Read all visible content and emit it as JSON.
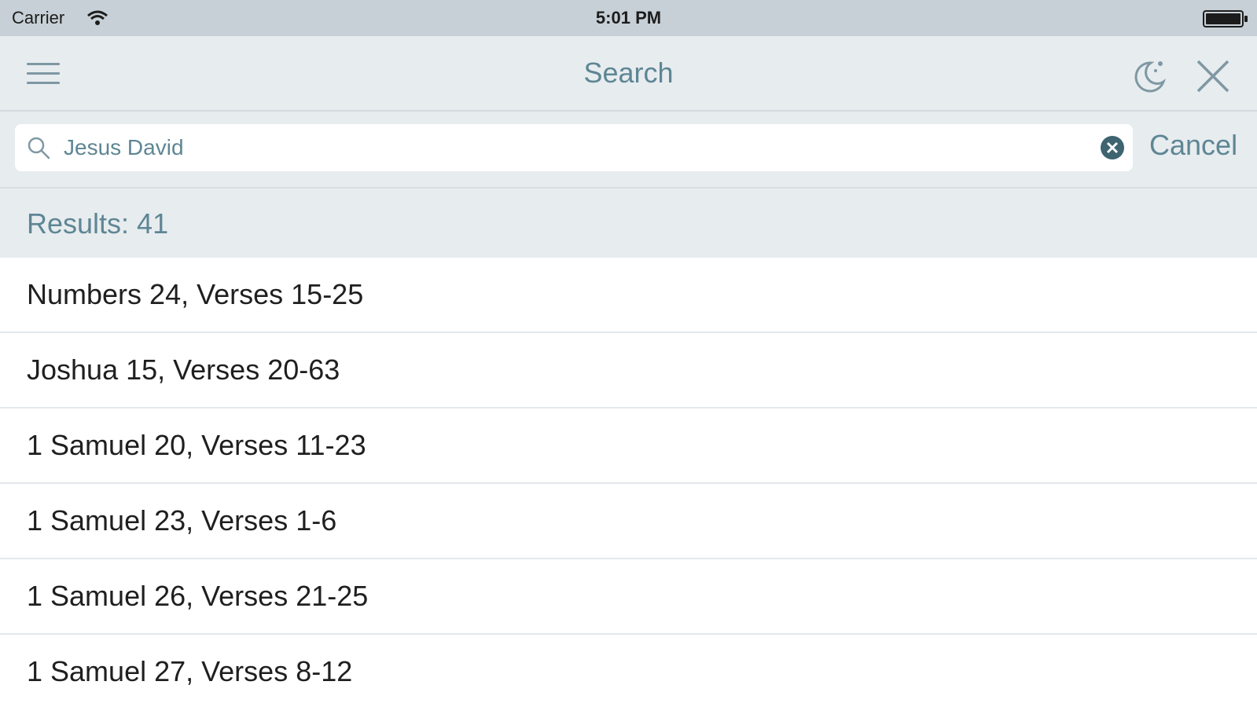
{
  "status_bar": {
    "carrier": "Carrier",
    "time": "5:01 PM"
  },
  "nav": {
    "title": "Search",
    "icons": [
      "menu-icon",
      "night-mode-icon",
      "close-icon"
    ]
  },
  "search": {
    "value": "Jesus David",
    "placeholder": "",
    "cancel_label": "Cancel"
  },
  "results": {
    "label": "Results: 41",
    "items": [
      {
        "label": "Numbers 24, Verses 15-25"
      },
      {
        "label": "Joshua 15, Verses 20-63"
      },
      {
        "label": "1 Samuel 20, Verses 11-23"
      },
      {
        "label": "1 Samuel 23, Verses 1-6"
      },
      {
        "label": "1 Samuel 26, Verses 21-25"
      },
      {
        "label": "1 Samuel 27, Verses 8-12"
      }
    ]
  },
  "colors": {
    "accent": "#5e8694",
    "bar_background": "#e7ecef",
    "status_background": "#c7d0d6",
    "text": "#1f1f1f"
  }
}
